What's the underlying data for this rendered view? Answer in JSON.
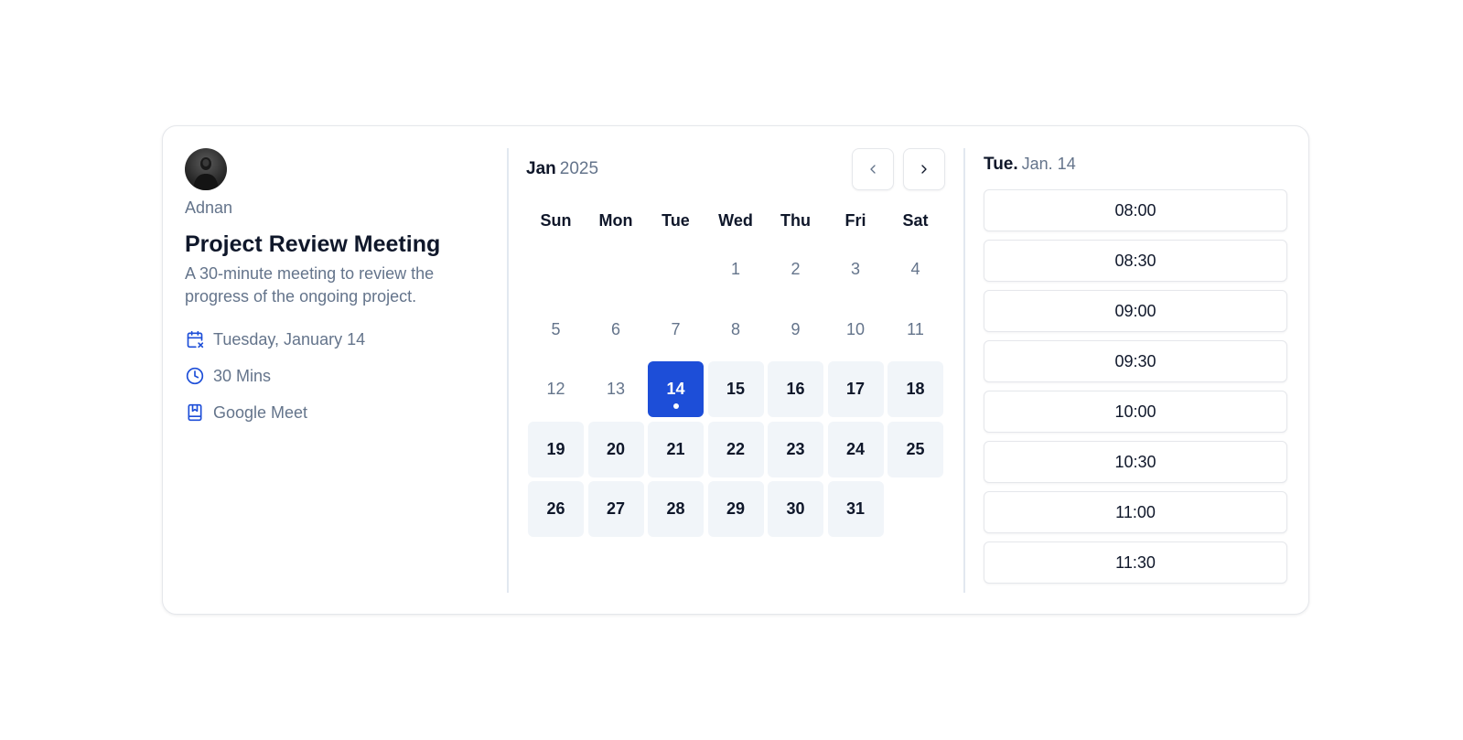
{
  "host": {
    "name": "Adnan"
  },
  "event": {
    "title": "Project Review Meeting",
    "description": "A 30-minute meeting to review the progress of the ongoing project.",
    "date": "Tuesday, January 14",
    "duration": "30 Mins",
    "location": "Google Meet"
  },
  "colors": {
    "accent": "#1d4ed8",
    "muted": "#64748b",
    "available_bg": "#f1f5f9"
  },
  "calendar": {
    "month": "Jan",
    "year": "2025",
    "weekdays": [
      "Sun",
      "Mon",
      "Tue",
      "Wed",
      "Thu",
      "Fri",
      "Sat"
    ],
    "leading_blank_days": 3,
    "days": [
      {
        "n": "1",
        "state": "unavailable"
      },
      {
        "n": "2",
        "state": "unavailable"
      },
      {
        "n": "3",
        "state": "unavailable"
      },
      {
        "n": "4",
        "state": "unavailable"
      },
      {
        "n": "5",
        "state": "unavailable"
      },
      {
        "n": "6",
        "state": "unavailable"
      },
      {
        "n": "7",
        "state": "unavailable"
      },
      {
        "n": "8",
        "state": "unavailable"
      },
      {
        "n": "9",
        "state": "unavailable"
      },
      {
        "n": "10",
        "state": "unavailable"
      },
      {
        "n": "11",
        "state": "unavailable"
      },
      {
        "n": "12",
        "state": "unavailable"
      },
      {
        "n": "13",
        "state": "unavailable"
      },
      {
        "n": "14",
        "state": "selected",
        "today": true
      },
      {
        "n": "15",
        "state": "available"
      },
      {
        "n": "16",
        "state": "available"
      },
      {
        "n": "17",
        "state": "available"
      },
      {
        "n": "18",
        "state": "available"
      },
      {
        "n": "19",
        "state": "available"
      },
      {
        "n": "20",
        "state": "available"
      },
      {
        "n": "21",
        "state": "available"
      },
      {
        "n": "22",
        "state": "available"
      },
      {
        "n": "23",
        "state": "available"
      },
      {
        "n": "24",
        "state": "available"
      },
      {
        "n": "25",
        "state": "available"
      },
      {
        "n": "26",
        "state": "available"
      },
      {
        "n": "27",
        "state": "available"
      },
      {
        "n": "28",
        "state": "available"
      },
      {
        "n": "29",
        "state": "available"
      },
      {
        "n": "30",
        "state": "available"
      },
      {
        "n": "31",
        "state": "available"
      }
    ],
    "prev_icon": "chevron-left-icon",
    "next_icon": "chevron-right-icon"
  },
  "slots": {
    "day_label": "Tue.",
    "date_label": "Jan. 14",
    "times": [
      "08:00",
      "08:30",
      "09:00",
      "09:30",
      "10:00",
      "10:30",
      "11:00",
      "11:30"
    ]
  }
}
